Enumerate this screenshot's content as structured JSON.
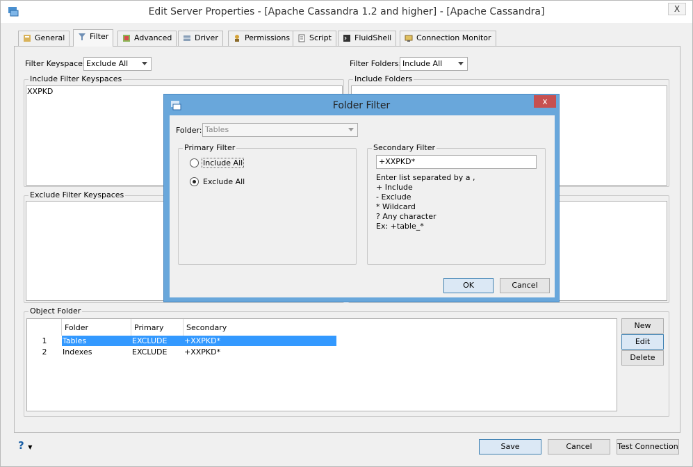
{
  "window": {
    "title": "Edit Server Properties - [Apache Cassandra 1.2 and higher] - [Apache Cassandra]",
    "close": "X"
  },
  "tabs": [
    {
      "label": "General",
      "icon": "general-icon"
    },
    {
      "label": "Filter",
      "icon": "filter-icon"
    },
    {
      "label": "Advanced",
      "icon": "advanced-icon"
    },
    {
      "label": "Driver",
      "icon": "driver-icon"
    },
    {
      "label": "Permissions",
      "icon": "permissions-icon"
    },
    {
      "label": "Script",
      "icon": "script-icon"
    },
    {
      "label": "FluidShell",
      "icon": "fluidshell-icon"
    },
    {
      "label": "Connection Monitor",
      "icon": "connection-monitor-icon"
    }
  ],
  "filter": {
    "keyspaces_label": "Filter Keyspaces",
    "keyspaces_value": "Exclude All",
    "folders_label": "Filter Folders:",
    "folders_value": "Include All",
    "include_keyspaces_title": "Include Filter Keyspaces",
    "include_keyspaces_items": [
      "XXPKD"
    ],
    "include_folders_title": "Include Folders",
    "exclude_keyspaces_title": "Exclude Filter Keyspaces"
  },
  "object_folder": {
    "title": "Object Folder",
    "columns": [
      "Folder",
      "Primary",
      "Secondary"
    ],
    "rows": [
      {
        "num": "1",
        "folder": "Tables",
        "primary": "EXCLUDE",
        "secondary": "+XXPKD*"
      },
      {
        "num": "2",
        "folder": "Indexes",
        "primary": "EXCLUDE",
        "secondary": "+XXPKD*"
      }
    ],
    "buttons": {
      "new": "New",
      "edit": "Edit",
      "delete": "Delete"
    }
  },
  "footer": {
    "help": "?",
    "save": "Save",
    "cancel": "Cancel",
    "test": "Test Connection"
  },
  "dialog": {
    "title": "Folder Filter",
    "close": "x",
    "folder_label": "Folder:",
    "folder_value": "Tables",
    "primary_title": "Primary Filter",
    "include_all": "Include All",
    "exclude_all": "Exclude All",
    "secondary_title": "Secondary Filter",
    "secondary_value": "+XXPKD*",
    "help_lines": [
      "Enter list separated by a ,",
      "+ Include",
      "- Exclude",
      "* Wildcard",
      "? Any character",
      "Ex: +table_*"
    ],
    "ok": "OK",
    "cancel": "Cancel"
  },
  "colors": {
    "selection": "#3399ff",
    "dialog_frame": "#69a7db",
    "close_red": "#c75050"
  }
}
